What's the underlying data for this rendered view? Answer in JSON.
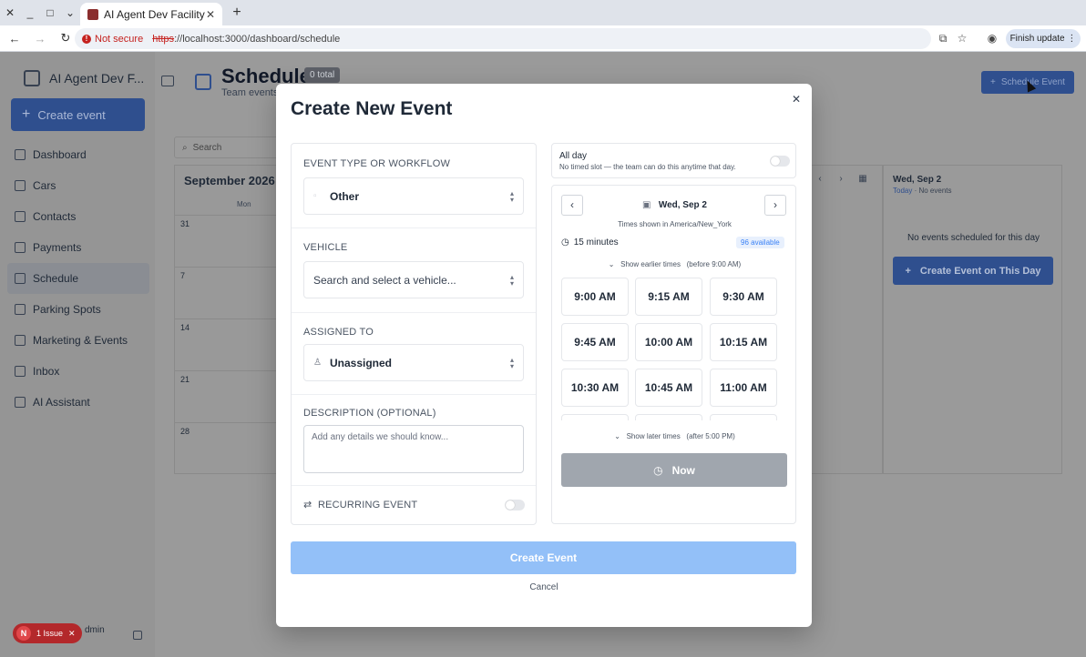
{
  "browser": {
    "tab_title": "AI Agent Dev Facility",
    "not_secure": "Not secure",
    "url_protocol": "https",
    "url_rest": "://localhost:3000/dashboard/schedule",
    "finish_update": "Finish update"
  },
  "sidebar": {
    "brand": "AI Agent Dev F...",
    "create_label": "Create event",
    "items": [
      {
        "label": "Dashboard",
        "icon": "grid-icon"
      },
      {
        "label": "Cars",
        "icon": "car-icon"
      },
      {
        "label": "Contacts",
        "icon": "users-icon"
      },
      {
        "label": "Payments",
        "icon": "card-icon"
      },
      {
        "label": "Schedule",
        "icon": "calendar-icon"
      },
      {
        "label": "Parking Spots",
        "icon": "pin-icon"
      },
      {
        "label": "Marketing & Events",
        "icon": "megaphone-icon"
      },
      {
        "label": "Inbox",
        "icon": "inbox-icon"
      },
      {
        "label": "AI Assistant",
        "icon": "globe-icon"
      }
    ],
    "user_name": "dmin",
    "issue_initial": "N",
    "issue_label": "1 Issue"
  },
  "page": {
    "title": "Schedule",
    "total_badge": "0 total",
    "subtitle": "Team events",
    "schedule_button": "Schedule Event",
    "search_placeholder": "Search",
    "month_title": "September 2026",
    "dow_label": "Mon",
    "week_days": [
      "31",
      "7",
      "14",
      "21",
      "28"
    ],
    "day_panel_title": "Wed, Sep 2",
    "day_panel_today": "Today",
    "day_panel_sub": "· No events",
    "no_events": "No events scheduled for this day",
    "create_on_day": "Create Event on This Day"
  },
  "modal": {
    "title": "Create New Event",
    "event_type_label": "EVENT TYPE OR WORKFLOW",
    "event_type_value": "Other",
    "vehicle_label": "VEHICLE",
    "vehicle_placeholder": "Search and select a vehicle...",
    "assigned_label": "ASSIGNED TO",
    "assigned_value": "Unassigned",
    "description_label": "DESCRIPTION (OPTIONAL)",
    "description_placeholder": "Add any details we should know...",
    "recurring_label": "RECURRING EVENT",
    "all_day_title": "All day",
    "all_day_sub": "No timed slot — the team can do this anytime that day.",
    "date_label": "Wed, Sep 2",
    "timezone": "Times shown in America/New_York",
    "duration": "15 minutes",
    "available": "96 available",
    "show_earlier": "Show earlier times",
    "show_earlier_hint": "(before 9:00 AM)",
    "show_later": "Show later times",
    "show_later_hint": "(after 5:00 PM)",
    "slots": [
      "9:00 AM",
      "9:15 AM",
      "9:30 AM",
      "9:45 AM",
      "10:00 AM",
      "10:15 AM",
      "10:30 AM",
      "10:45 AM",
      "11:00 AM"
    ],
    "now_label": "Now",
    "create_button": "Create Event",
    "cancel": "Cancel"
  }
}
